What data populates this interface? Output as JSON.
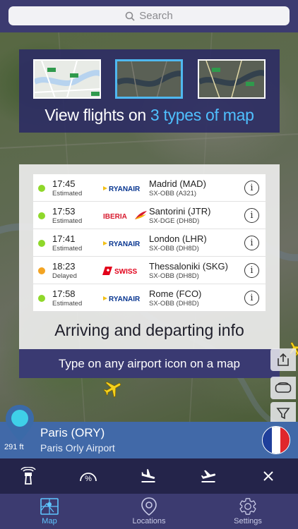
{
  "search": {
    "placeholder": "Search"
  },
  "promo_maps": {
    "title_prefix": "View flights on ",
    "title_accent": "3 types of map"
  },
  "promo_info": {
    "heading": "Arriving and departing info",
    "banner": "Type on any airport icon on a map",
    "flights": [
      {
        "time": "17:45",
        "status": "Estimated",
        "status_color": "#8fd82a",
        "airline": "RYANAIR",
        "destination": "Madrid (MAD)",
        "registration": "SX-OBB (A321)"
      },
      {
        "time": "17:53",
        "status": "Estimated",
        "status_color": "#8fd82a",
        "airline": "IBERIA",
        "destination": "Santorini (JTR)",
        "registration": "SX-DGE (DH8D)"
      },
      {
        "time": "17:41",
        "status": "Estimated",
        "status_color": "#8fd82a",
        "airline": "RYANAIR",
        "destination": "London (LHR)",
        "registration": "SX-OBB (DH8D)"
      },
      {
        "time": "18:23",
        "status": "Delayed",
        "status_color": "#f3a423",
        "airline": "SWISS",
        "destination": "Thessaloniki (SKG)",
        "registration": "SX-OBB (DH8D)"
      },
      {
        "time": "17:58",
        "status": "Estimated",
        "status_color": "#8fd82a",
        "airline": "RYANAIR",
        "destination": "Rome (FCO)",
        "registration": "SX-OBB (DH8D)"
      }
    ]
  },
  "airport": {
    "elevation": "291 ft",
    "code": "Paris (ORY)",
    "name": "Paris Orly Airport",
    "flag_colors": [
      "#1f3f9b",
      "#ffffff",
      "#e0262b"
    ]
  },
  "tabs": [
    {
      "label": "Map",
      "icon": "map-icon",
      "active": true
    },
    {
      "label": "Locations",
      "icon": "location-pin-icon",
      "active": false
    },
    {
      "label": "Settings",
      "icon": "gear-icon",
      "active": false
    }
  ],
  "colors": {
    "accent": "#4fc0ff",
    "header": "#3c3b70",
    "airport_bar": "#4169a8"
  }
}
